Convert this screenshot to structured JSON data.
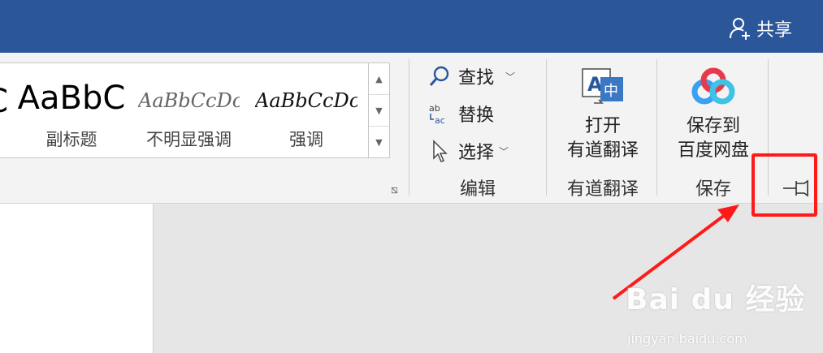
{
  "titlebar": {
    "share_label": "共享"
  },
  "styles_gallery": {
    "partial_sample": "C",
    "tiles": [
      {
        "sample": "AaBbC",
        "name": "副标题"
      },
      {
        "sample": "AaBbCcDc",
        "name": "不明显强调"
      },
      {
        "sample": "AaBbCcDc",
        "name": "强调"
      }
    ]
  },
  "editing": {
    "find_label": "查找",
    "replace_label": "替换",
    "select_label": "选择",
    "group_label": "编辑"
  },
  "youdao": {
    "button_line1": "打开",
    "button_line2": "有道翻译",
    "group_label": "有道翻译"
  },
  "save": {
    "button_line1": "保存到",
    "button_line2": "百度网盘",
    "group_label": "保存"
  },
  "colors": {
    "titlebar": "#2b579a",
    "annotation": "#ff1a1a",
    "ribbon_bg": "#f3f3f3",
    "workspace_bg": "#e6e6e6"
  },
  "icons": {
    "share": "add-person-icon",
    "find": "magnifier-icon",
    "replace": "ab-ac-replace-icon",
    "select": "cursor-arrow-icon",
    "youdao": "translate-icon",
    "baidu": "baidu-netdisk-icon",
    "pin": "pin-ribbon-icon"
  },
  "watermark": {
    "logo_text": "Bai du 经验",
    "url": "jingyan.baidu.com"
  }
}
